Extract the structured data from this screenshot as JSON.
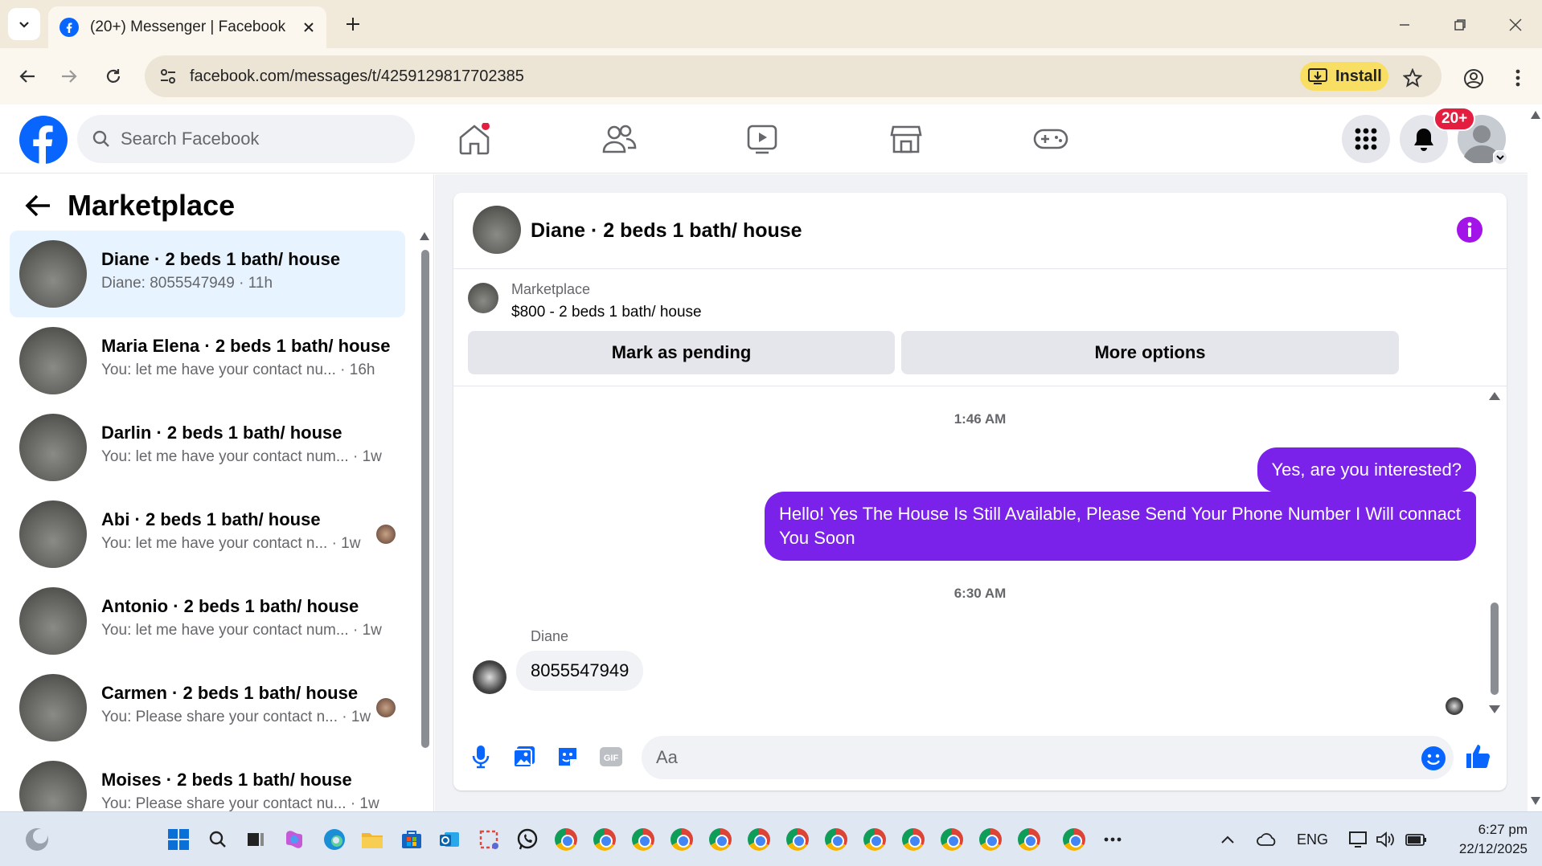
{
  "browser": {
    "tab_title": "(20+) Messenger | Facebook",
    "url": "facebook.com/messages/t/4259129817702385",
    "install_label": "Install"
  },
  "fb": {
    "search_placeholder": "Search Facebook",
    "notifications_badge": "20+",
    "brand_color": "#0866ff"
  },
  "left_panel": {
    "title": "Marketplace",
    "conversations": [
      {
        "name": "Diane · 2 beds 1 bath/ house",
        "snippet": "Diane: 8055547949 · 11h",
        "active": true
      },
      {
        "name": "Maria Elena · 2 beds 1 bath/ house",
        "snippet": "You: let me have your contact nu...  · 16h"
      },
      {
        "name": "Darlin · 2 beds 1 bath/ house",
        "snippet": "You: let me have your contact num... · 1w"
      },
      {
        "name": "Abi · 2 beds 1 bath/ house",
        "snippet": "You: let me have your contact n...  · 1w"
      },
      {
        "name": "Antonio · 2 beds 1 bath/ house",
        "snippet": "You: let me have your contact num... · 1w"
      },
      {
        "name": "Carmen · 2 beds 1 bath/ house",
        "snippet": "You: Please share your contact n...  · 1w"
      },
      {
        "name": "Moises · 2 beds 1 bath/ house",
        "snippet": "You: Please share your contact nu...  · 1w"
      }
    ]
  },
  "chat": {
    "header_title": "Diane · 2 beds 1 bath/ house",
    "listing_label": "Marketplace",
    "listing_price": "$800 - 2 beds 1 bath/ house",
    "mark_pending_label": "Mark as pending",
    "more_options_label": "More options",
    "messages": [
      {
        "type": "time",
        "text": "1:46 AM"
      },
      {
        "type": "out",
        "text": "Yes, are you interested?"
      },
      {
        "type": "out",
        "text": "Hello! Yes The House  Is Still Available, Please Send Your Phone Number I Will connact You Soon"
      },
      {
        "type": "time",
        "text": "6:30 AM"
      },
      {
        "type": "in",
        "sender": "Diane",
        "text": "8055547949"
      }
    ],
    "composer_placeholder": "Aa",
    "accent_color": "#7b22ea"
  },
  "taskbar": {
    "language": "ENG",
    "time": "6:27 pm",
    "date": "22/12/2025"
  }
}
